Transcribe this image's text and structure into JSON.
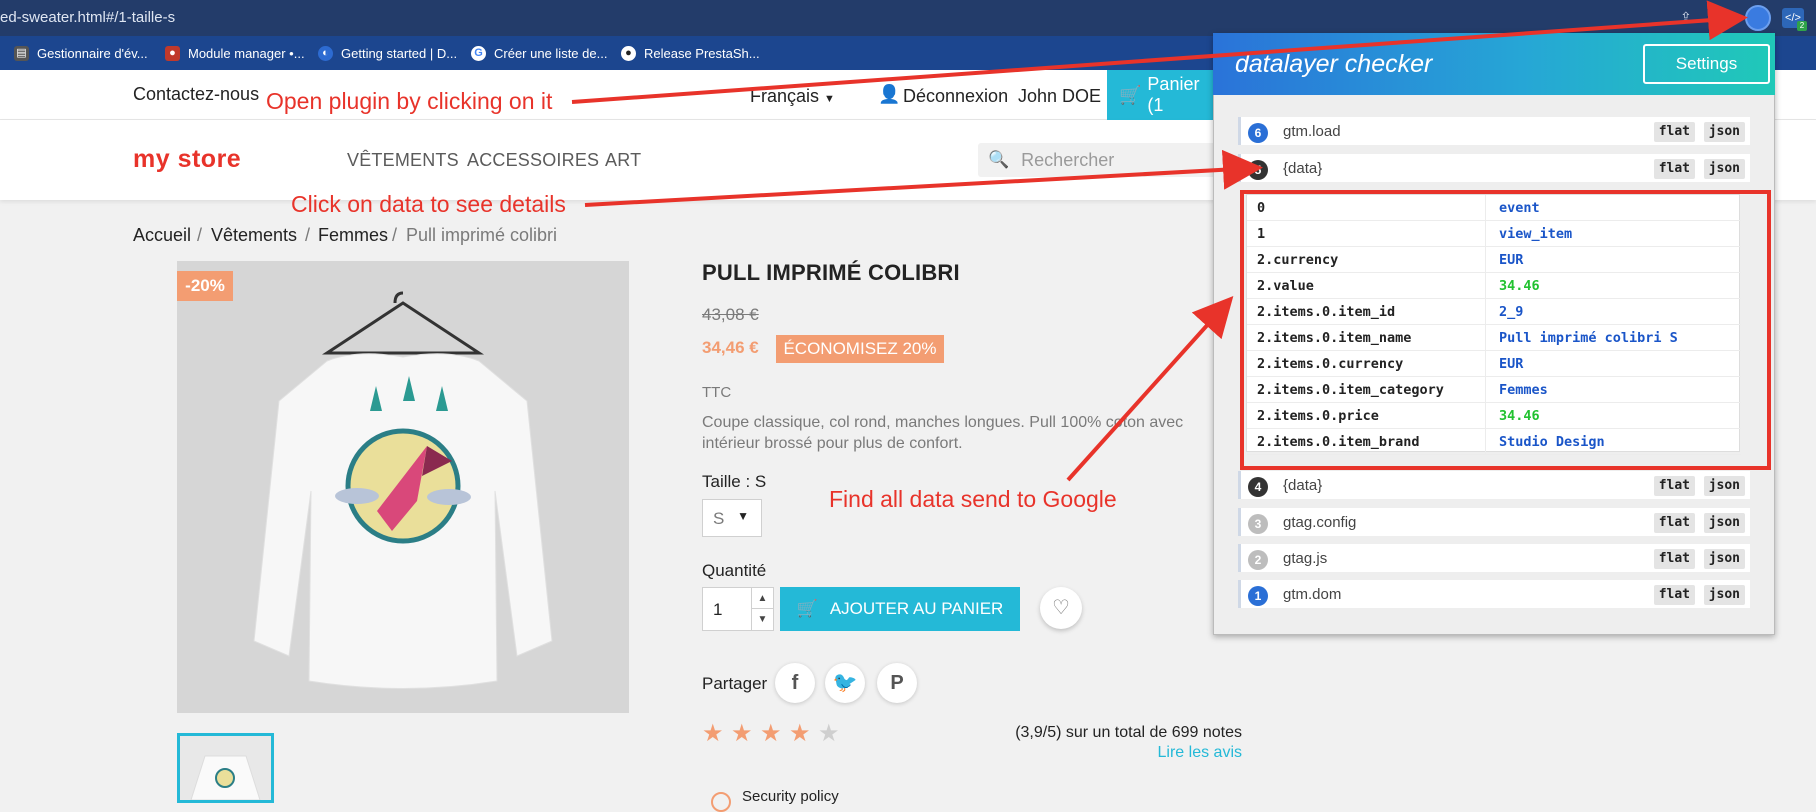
{
  "browser": {
    "url": "ed-sweater.html#/1-taille-s",
    "bookmarks": [
      {
        "label": "Gestionnaire d'év...",
        "color": "#555555"
      },
      {
        "label": "Module manager •...",
        "color": "#c0392b"
      },
      {
        "label": "Getting started | D...",
        "color": "#2d6bd1"
      },
      {
        "label": "Créer une liste de...",
        "color": "#ffffff"
      },
      {
        "label": "Release PrestaSh...",
        "color": "#333333"
      }
    ],
    "extension_badge": "2"
  },
  "site": {
    "topnav": {
      "contact": "Contactez-nous",
      "language": "Français",
      "logout": "Déconnexion",
      "user": "John DOE",
      "cart": "Panier (1"
    },
    "logo": "my store",
    "menu": [
      "VÊTEMENTS",
      "ACCESSOIRES",
      "ART"
    ],
    "search_placeholder": "Rechercher",
    "breadcrumb": [
      "Accueil",
      "Vêtements",
      "Femmes",
      "Pull imprimé colibri"
    ],
    "breadcrumb_sep": "/"
  },
  "product": {
    "discount_badge": "-20%",
    "title": "PULL IMPRIMÉ COLIBRI",
    "old_price": "43,08 €",
    "new_price": "34,46 €",
    "save_badge": "ÉCONOMISEZ 20%",
    "tax_label": "TTC",
    "description": "Coupe classique, col rond, manches longues. Pull 100% coton avec intérieur brossé pour plus de confort.",
    "size_label": "Taille : S",
    "size_value": "S",
    "qty_label": "Quantité",
    "qty_value": "1",
    "add_to_cart": "AJOUTER AU PANIER",
    "share_label": "Partager",
    "rating_value": 4,
    "rating_max": 5,
    "rating_text": "(3,9/5) sur un total de 699 notes",
    "reviews_link": "Lire les avis",
    "policy": "Security policy"
  },
  "plugin": {
    "title": "datalayer checker",
    "settings": "Settings",
    "flat_label": "flat",
    "json_label": "json",
    "events_top": [
      {
        "num": "6",
        "name": "gtm.load",
        "color": "#2a6fd6"
      },
      {
        "num": "5",
        "name": "{data}",
        "color": "#333333"
      }
    ],
    "data_rows": [
      {
        "key": "0",
        "value": "event",
        "color": "#1a55c8"
      },
      {
        "key": "1",
        "value": "view_item",
        "color": "#1a55c8"
      },
      {
        "key": "2.currency",
        "value": "EUR",
        "color": "#1a55c8"
      },
      {
        "key": "2.value",
        "value": "34.46",
        "color": "#22c230"
      },
      {
        "key": "2.items.0.item_id",
        "value": "2_9",
        "color": "#1a55c8"
      },
      {
        "key": "2.items.0.item_name",
        "value": "Pull imprimé colibri S",
        "color": "#1a55c8"
      },
      {
        "key": "2.items.0.currency",
        "value": "EUR",
        "color": "#1a55c8"
      },
      {
        "key": "2.items.0.item_category",
        "value": "Femmes",
        "color": "#1a55c8"
      },
      {
        "key": "2.items.0.price",
        "value": "34.46",
        "color": "#22c230"
      },
      {
        "key": "2.items.0.item_brand",
        "value": "Studio Design",
        "color": "#1a55c8"
      }
    ],
    "events_bottom": [
      {
        "num": "4",
        "name": "{data}",
        "color": "#333333"
      },
      {
        "num": "3",
        "name": "gtag.config",
        "color": "#bdbdbd"
      },
      {
        "num": "2",
        "name": "gtag.js",
        "color": "#bdbdbd"
      },
      {
        "num": "1",
        "name": "gtm.dom",
        "color": "#2a6fd6"
      }
    ]
  },
  "annotations": {
    "open_plugin": "Open plugin by clicking on it",
    "click_data": "Click on data to see details",
    "find_data": "Find all data send to Google"
  },
  "colors": {
    "accent": "#24b9d7",
    "sale": "#f39d72",
    "annotation": "#e8332a"
  }
}
